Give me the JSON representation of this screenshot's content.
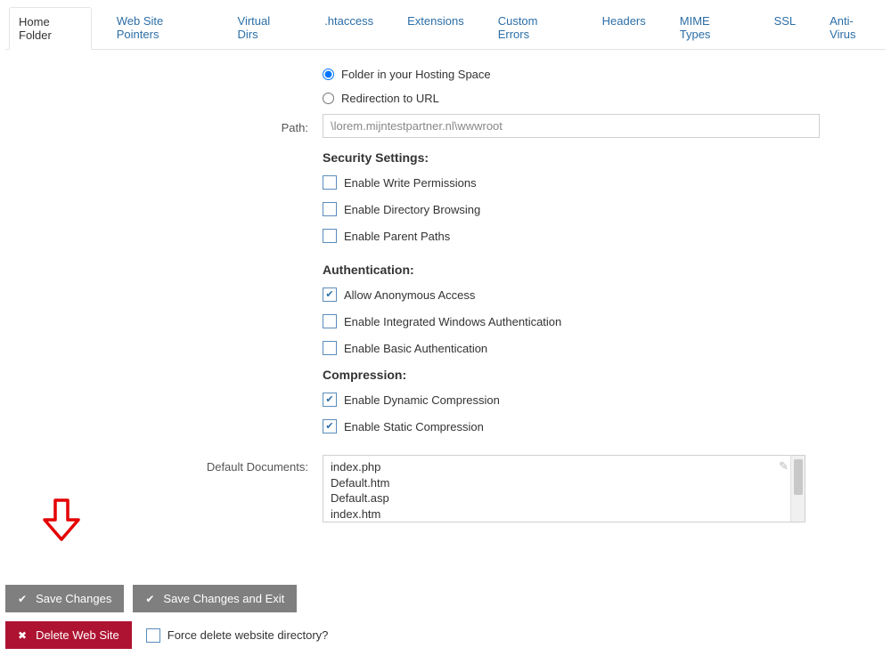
{
  "tabs": {
    "items": [
      "Home Folder",
      "Web Site Pointers",
      "Virtual Dirs",
      ".htaccess",
      "Extensions",
      "Custom Errors",
      "Headers",
      "MIME Types",
      "SSL",
      "Anti-Virus"
    ],
    "active_index": 0
  },
  "folder_mode": {
    "opt_folder": "Folder in your Hosting Space",
    "opt_redirect": "Redirection to URL",
    "selected": "folder"
  },
  "path": {
    "label": "Path:",
    "value": "\\lorem.mijntestpartner.nl\\wwwroot"
  },
  "security": {
    "heading": "Security Settings:",
    "items": [
      {
        "label": "Enable Write Permissions",
        "checked": false
      },
      {
        "label": "Enable Directory Browsing",
        "checked": false
      },
      {
        "label": "Enable Parent Paths",
        "checked": false
      }
    ]
  },
  "auth": {
    "heading": "Authentication:",
    "items": [
      {
        "label": "Allow Anonymous Access",
        "checked": true
      },
      {
        "label": "Enable Integrated Windows Authentication",
        "checked": false
      },
      {
        "label": "Enable Basic Authentication",
        "checked": false
      }
    ]
  },
  "compression": {
    "heading": "Compression:",
    "items": [
      {
        "label": "Enable Dynamic Compression",
        "checked": true
      },
      {
        "label": "Enable Static Compression",
        "checked": true
      }
    ]
  },
  "default_docs": {
    "label": "Default Documents:",
    "content": "index.php\nDefault.htm\nDefault.asp\nindex.htm\nindex.html"
  },
  "actions": {
    "save_changes": "Save Changes",
    "save_exit": "Save Changes and Exit",
    "delete_site": "Delete Web Site",
    "force_delete": "Force delete website directory?"
  }
}
